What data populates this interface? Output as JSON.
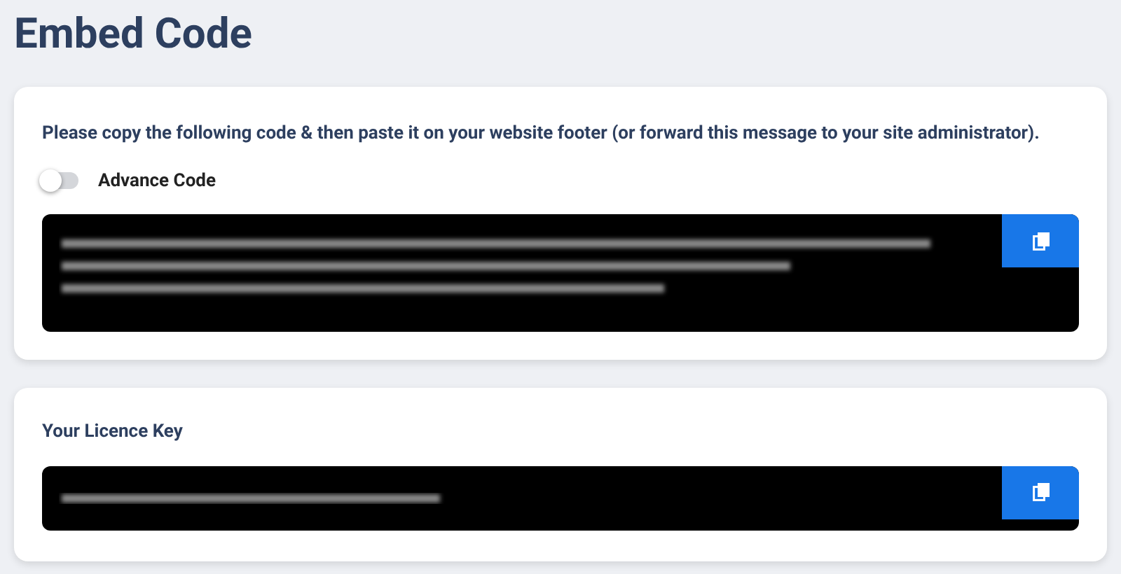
{
  "title": "Embed Code",
  "embed_card": {
    "instruction": "Please copy the following code & then paste it on your website footer (or forward this message to your site administrator).",
    "toggle": {
      "label": "Advance Code",
      "on": false
    }
  },
  "licence_card": {
    "heading": "Your Licence Key"
  }
}
